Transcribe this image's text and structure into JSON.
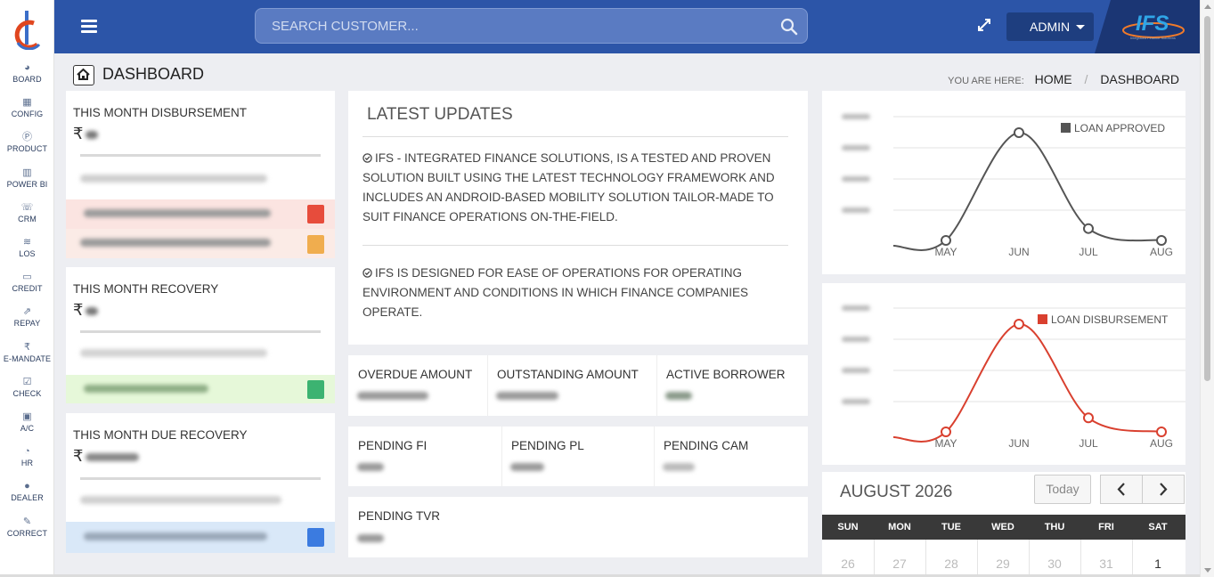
{
  "sidebar": {
    "items": [
      {
        "label": "BOARD",
        "icon": "dashboard-gauge-icon"
      },
      {
        "label": "CONFIG",
        "icon": "grid-icon"
      },
      {
        "label": "PRODUCT",
        "icon": "product-p-icon"
      },
      {
        "label": "POWER BI",
        "icon": "bar-chart-icon"
      },
      {
        "label": "CRM",
        "icon": "crm-icon"
      },
      {
        "label": "LOS",
        "icon": "database-icon"
      },
      {
        "label": "CREDIT",
        "icon": "credit-card-icon"
      },
      {
        "label": "REPAY",
        "icon": "external-link-icon"
      },
      {
        "label": "E-MANDATE",
        "icon": "rupee-icon"
      },
      {
        "label": "CHECK",
        "icon": "checkbox-icon"
      },
      {
        "label": "A/C",
        "icon": "account-card-icon"
      },
      {
        "label": "HR",
        "icon": "pie-chart-icon"
      },
      {
        "label": "DEALER",
        "icon": "user-icon"
      },
      {
        "label": "CORRECT",
        "icon": "edit-icon"
      }
    ]
  },
  "header": {
    "search_placeholder": "SEARCH CUSTOMER...",
    "user_label": "ADMIN",
    "brand_text": "IFS"
  },
  "page": {
    "title": "DASHBOARD",
    "breadcrumb_prefix": "YOU ARE HERE:",
    "breadcrumb": [
      "HOME",
      "DASHBOARD"
    ]
  },
  "cards": {
    "disbursement": {
      "title": "THIS MONTH DISBURSEMENT",
      "currency": "₹"
    },
    "recovery": {
      "title": "THIS MONTH RECOVERY",
      "currency": "₹"
    },
    "due_recovery": {
      "title": "THIS MONTH DUE RECOVERY",
      "currency": "₹"
    }
  },
  "updates": {
    "heading": "LATEST UPDATES",
    "items": [
      "IFS - INTEGRATED FINANCE SOLUTIONS, IS A TESTED AND PROVEN SOLUTION BUILT USING THE LATEST TECHNOLOGY FRAMEWORK AND INCLUDES AN ANDROID-BASED MOBILITY SOLUTION TAILOR-MADE TO SUIT FINANCE OPERATIONS ON-THE-FIELD.",
      "IFS IS DESIGNED FOR EASE OF OPERATIONS FOR OPERATING ENVIRONMENT AND CONDITIONS IN WHICH FINANCE COMPANIES OPERATE."
    ]
  },
  "stats": {
    "row1": [
      "OVERDUE AMOUNT",
      "OUTSTANDING AMOUNT",
      "ACTIVE BORROWER"
    ],
    "row2": [
      "PENDING FI",
      "PENDING PL",
      "PENDING CAM"
    ],
    "row3": [
      "PENDING TVR"
    ]
  },
  "chart_data": [
    {
      "type": "line",
      "x": [
        "MAY",
        "JUN",
        "JUL",
        "AUG"
      ],
      "series": [
        {
          "name": "LOAN APPROVED",
          "color": "#555555",
          "values": [
            0,
            1,
            0.11,
            0
          ]
        }
      ],
      "note_values": "relative curve heights; y-axis tick values are blurred"
    },
    {
      "type": "line",
      "x": [
        "MAY",
        "JUN",
        "JUL",
        "AUG"
      ],
      "series": [
        {
          "name": "LOAN DISBURSEMENT",
          "color": "#d9402f",
          "values": [
            0,
            1,
            0.13,
            0
          ]
        }
      ],
      "note_values": "relative curve heights; y-axis tick values are blurred"
    }
  ],
  "calendar": {
    "month_label": "AUGUST 2026",
    "today_label": "Today",
    "weekdays": [
      "SUN",
      "MON",
      "TUE",
      "WED",
      "THU",
      "FRI",
      "SAT"
    ],
    "first_row": [
      "26",
      "27",
      "28",
      "29",
      "30",
      "31",
      "1"
    ]
  },
  "colors": {
    "header": "#2c55a8",
    "danger": "#e74c3c",
    "warning": "#f0ad4e",
    "success": "#3cb371",
    "info": "#3b7be0",
    "approved_line": "#555555",
    "disbursement_line": "#d9402f"
  }
}
